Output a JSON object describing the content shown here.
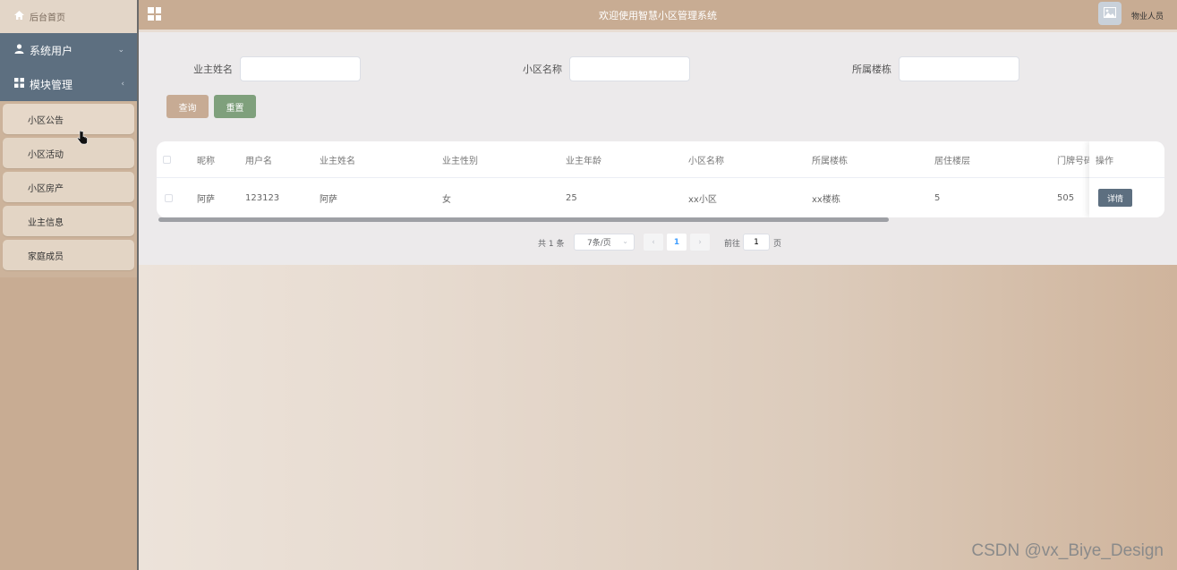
{
  "sidebar": {
    "home_label": "后台首页",
    "groups": [
      {
        "label": "系统用户",
        "arrow": "⌄"
      },
      {
        "label": "模块管理",
        "arrow": "‹"
      }
    ],
    "sub_items": [
      "小区公告",
      "小区活动",
      "小区房产",
      "业主信息",
      "家庭成员"
    ]
  },
  "header": {
    "title": "欢迎使用智慧小区管理系统",
    "role": "物业人员"
  },
  "search": {
    "owner_name_label": "业主姓名",
    "community_label": "小区名称",
    "building_label": "所属楼栋",
    "owner_name_value": "",
    "community_value": "",
    "building_value": ""
  },
  "buttons": {
    "query": "查询",
    "reset": "重置"
  },
  "table": {
    "headers": [
      "昵称",
      "用户名",
      "业主姓名",
      "业主性别",
      "业主年龄",
      "小区名称",
      "所属楼栋",
      "居住楼层",
      "门牌号码"
    ],
    "op_header": "操作",
    "rows": [
      [
        "阿萨",
        "123123",
        "阿萨",
        "女",
        "25",
        "xx小区",
        "xx楼栋",
        "5",
        "505"
      ]
    ],
    "detail_label": "详情"
  },
  "pagination": {
    "total": "共 1 条",
    "page_size": "7条/页",
    "current_page": "1",
    "goto_label": "前往",
    "goto_value": "1",
    "page_suffix": "页"
  },
  "watermark": "CSDN @vx_Biye_Design",
  "colors": {
    "header": "#c8ac93",
    "group": "#5d6f80",
    "reset": "#7fa07c",
    "query": "#c7ab94"
  }
}
